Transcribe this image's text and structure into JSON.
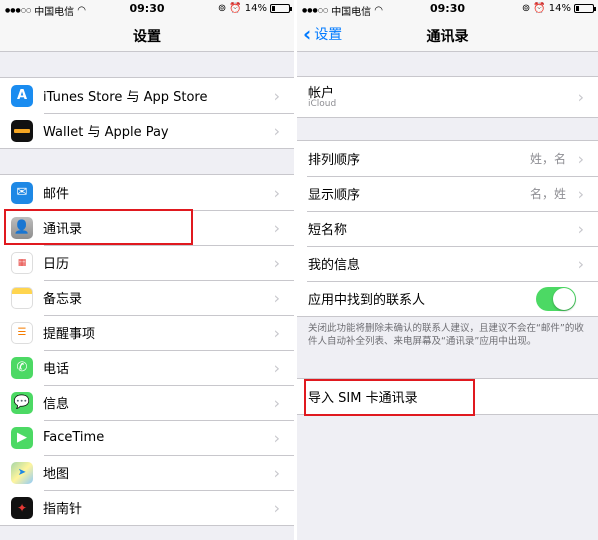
{
  "status_bar": {
    "carrier": "中国电信",
    "time": "09:30",
    "battery": "14%"
  },
  "left": {
    "nav_title": "设置",
    "group1": [
      {
        "label": "iTunes Store 与 App Store",
        "icon": "app-store-icon"
      },
      {
        "label": "Wallet 与 Apple Pay",
        "icon": "wallet-icon"
      }
    ],
    "group2": [
      {
        "label": "邮件",
        "icon": "mail-icon"
      },
      {
        "label": "通讯录",
        "icon": "contacts-icon"
      },
      {
        "label": "日历",
        "icon": "calendar-icon"
      },
      {
        "label": "备忘录",
        "icon": "notes-icon"
      },
      {
        "label": "提醒事项",
        "icon": "reminders-icon"
      },
      {
        "label": "电话",
        "icon": "phone-icon"
      },
      {
        "label": "信息",
        "icon": "messages-icon"
      },
      {
        "label": "FaceTime",
        "icon": "facetime-icon"
      },
      {
        "label": "地图",
        "icon": "maps-icon"
      },
      {
        "label": "指南针",
        "icon": "compass-icon"
      }
    ]
  },
  "right": {
    "back_label": "设置",
    "nav_title": "通讯录",
    "account": {
      "label": "帐户",
      "sub": "iCloud"
    },
    "rows": [
      {
        "label": "排列顺序",
        "value": "姓，名"
      },
      {
        "label": "显示顺序",
        "value": "名，姓"
      },
      {
        "label": "短名称",
        "value": ""
      },
      {
        "label": "我的信息",
        "value": ""
      },
      {
        "label": "应用中找到的联系人",
        "value": ""
      }
    ],
    "found_contacts_switch": "on",
    "footer_note": "关闭此功能将删除未确认的联系人建议，且建议不会在“邮件”的收件人自动补全列表、来电屏幕及“通讯录”应用中出现。",
    "import_sim": "导入 SIM 卡通讯录"
  },
  "colors": {
    "accent": "#007aff",
    "switch_on": "#4cd964",
    "highlight": "#e0191f"
  }
}
